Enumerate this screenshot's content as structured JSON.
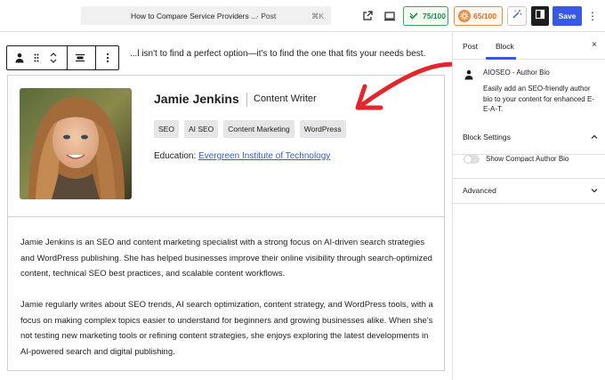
{
  "topbar": {
    "doc_title": "How to Compare Service Providers ...",
    "doc_type": "· Post",
    "shortcut": "⌘K",
    "score_seo": "75/100",
    "score_other": "65/100",
    "save_label": "Save",
    "more_label": "⋮"
  },
  "editor": {
    "intro_text": "...l isn't to find a perfect option—it's to find the one that fits your needs best.",
    "author": {
      "name": "Jamie Jenkins",
      "job_title": "Content Writer",
      "tags": [
        "SEO",
        "AI SEO",
        "Content Marketing",
        "WordPress"
      ],
      "education_label": "Education:",
      "education_value": "Evergreen Institute of Technology",
      "bio_paragraphs": [
        "Jamie Jenkins is an SEO and content marketing specialist with a strong focus on AI-driven search strategies and WordPress publishing. She has helped businesses improve their online visibility through search-optimized content, technical SEO best practices, and scalable content workflows.",
        "Jamie regularly writes about SEO trends, AI search optimization, content strategy, and WordPress tools, with a focus on making complex topics easier to understand for beginners and growing businesses alike. When she's not testing new marketing tools or refining content strategies, she enjoys exploring the latest developments in AI-powered search and digital publishing."
      ]
    }
  },
  "sidebar": {
    "tabs": [
      "Post",
      "Block"
    ],
    "active_tab": "Block",
    "close_label": "×",
    "block": {
      "title": "AIOSEO - Author Bio",
      "description": "Easily add an SEO-friendly author bio to your content for enhanced E-E-A-T."
    },
    "panels": {
      "block_settings": "Block Settings",
      "toggle_label": "Show Compact Author Bio",
      "advanced": "Advanced"
    }
  },
  "colors": {
    "accent": "#3858e9",
    "score_green": "#1f8a3f",
    "score_orange": "#d96f1c",
    "arrow_red": "#e3262b",
    "link": "#2b5ed6"
  },
  "icons": [
    "aioseo-icon",
    "external-link-icon",
    "desktop-preview-icon",
    "wand-icon",
    "sidebar-toggle-icon",
    "person-block-icon",
    "drag-handle-icon",
    "move-up-down-icon",
    "align-icon",
    "more-options-icon",
    "close-icon",
    "chevron-up-icon",
    "chevron-down-icon"
  ]
}
